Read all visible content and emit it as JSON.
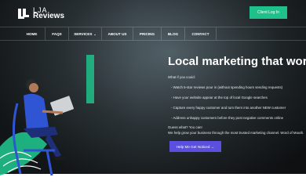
{
  "brand": {
    "line1": "LJA",
    "line2": "Reviews"
  },
  "header": {
    "login_label": "Client Log In"
  },
  "nav": {
    "items": [
      {
        "label": "HOME"
      },
      {
        "label": "FAQS"
      },
      {
        "label": "SERVICES"
      },
      {
        "label": "ABOUT US"
      },
      {
        "label": "PRICING"
      },
      {
        "label": "BLOG"
      },
      {
        "label": "CONTACT"
      }
    ]
  },
  "hero": {
    "headline": "Local marketing that work",
    "intro": "What if you could:",
    "bullets": [
      "- Watch 5-star reviews pour in (without spending hours sending requests)",
      "- Have your website appear at the top of local Google searches",
      "- Capture every happy customer and turn them into another NEW customer",
      "- Address unhappy customers before they post negative comments online"
    ],
    "guess": "Guess what? You can!",
    "tagline": "We help grow your business through the most trusted marketing channel. Word of Mouth.",
    "cta_label": "Help Me Get Noticed →"
  },
  "colors": {
    "accent_green": "#1fc18a",
    "cta_purple": "#5b4fe0",
    "illustration_blue": "#2f55d4"
  }
}
